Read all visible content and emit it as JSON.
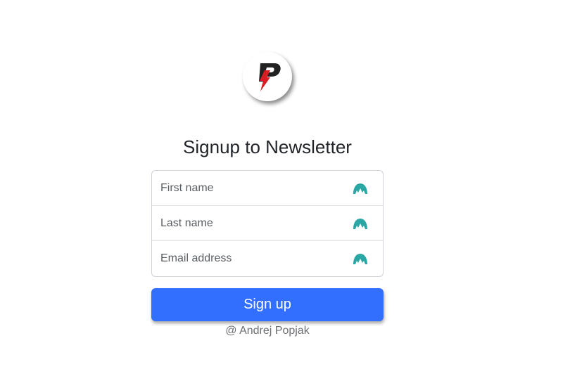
{
  "logo": {
    "icon": "brand-p-lightning-logo",
    "colors": {
      "letter": "#222222",
      "bolt": "#d81e22"
    }
  },
  "title": "Signup to Newsletter",
  "form": {
    "fields": [
      {
        "name": "first-name",
        "placeholder": "First name",
        "value": ""
      },
      {
        "name": "last-name",
        "placeholder": "Last name",
        "value": ""
      },
      {
        "name": "email",
        "placeholder": "Email address",
        "value": ""
      }
    ],
    "field_icon": "vpn-extension-icon",
    "field_icon_color": "#2aa7a5"
  },
  "submit_label": "Sign up",
  "credit": "@ Andrej Popjak",
  "colors": {
    "primary": "#326fff",
    "text": "#212529",
    "border": "#ced4da"
  }
}
